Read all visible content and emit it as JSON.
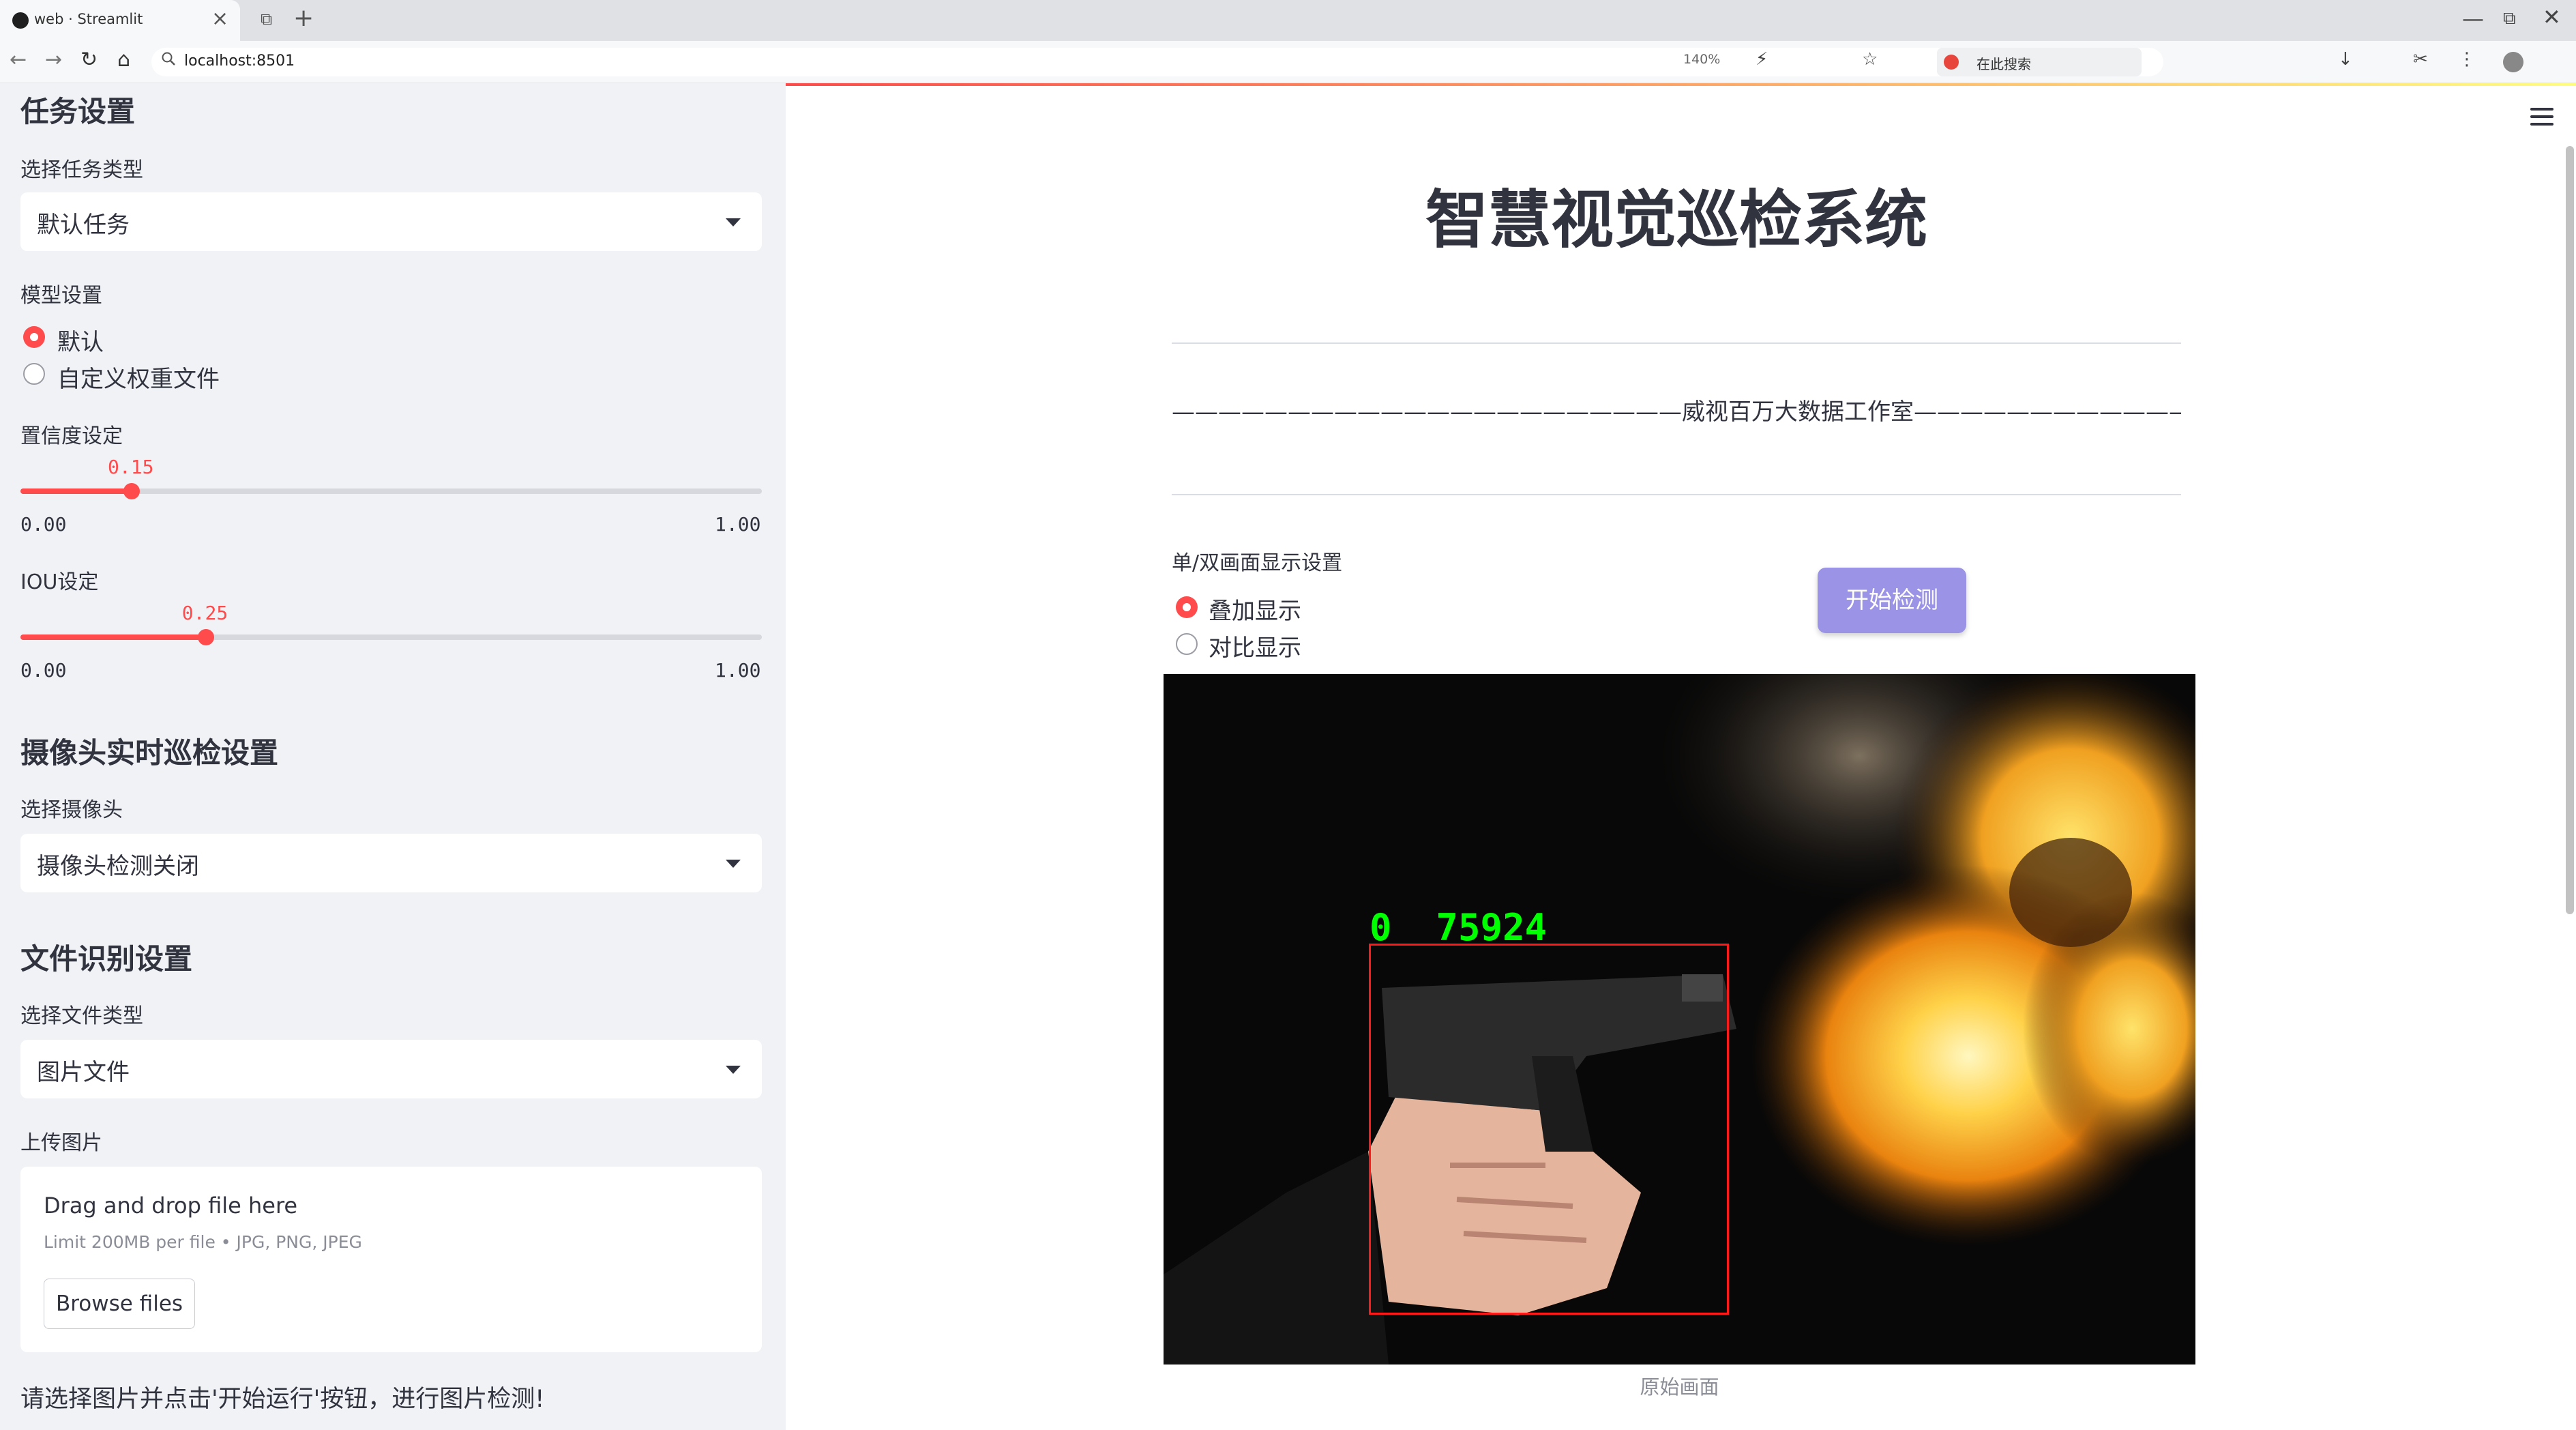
{
  "browser": {
    "tab_title": "web · Streamlit",
    "tab_close": "×",
    "tab_dup": "⧉",
    "tab_new": "+",
    "address": "localhost:8501",
    "zoom": "140%",
    "search_box": "在此搜索",
    "window_controls": {
      "minimize": "—",
      "restore": "⧉",
      "close": "✕"
    },
    "nav_icons": [
      "back-icon",
      "forward-icon",
      "reload-icon",
      "home-icon"
    ],
    "nav_glyphs": {
      "back": "←",
      "forward": "→",
      "reload": "↻",
      "home": "⌂"
    },
    "toolbar_glyphs": [
      "⚡",
      "☆",
      "↓",
      "✂",
      "⋮"
    ]
  },
  "sidebar": {
    "task_settings": {
      "heading": "任务设置",
      "select_label": "选择任务类型",
      "select_value": "默认任务"
    },
    "model_settings": {
      "label": "模型设置",
      "options": [
        "默认",
        "自定义权重文件"
      ],
      "selected_index": 0
    },
    "confidence": {
      "label": "置信度设定",
      "value": "0.15",
      "value_num": 0.15,
      "min": "0.00",
      "max": "1.00"
    },
    "iou": {
      "label": "IOU设定",
      "value": "0.25",
      "value_num": 0.25,
      "min": "0.00",
      "max": "1.00"
    },
    "camera": {
      "heading": "摄像头实时巡检设置",
      "select_label": "选择摄像头",
      "select_value": "摄像头检测关闭"
    },
    "file": {
      "heading": "文件识别设置",
      "select_label": "选择文件类型",
      "select_value": "图片文件",
      "upload_label": "上传图片",
      "drag_text": "Drag and drop file here",
      "limit_text": "Limit 200MB per file • JPG, PNG, JPEG",
      "browse_label": "Browse files"
    },
    "hint": "请选择图片并点击'开始运行'按钮，进行图片检测!"
  },
  "main": {
    "title": "智慧视觉巡检系统",
    "subtitle_line": "——————————————————————威视百万大数据工作室———————————————————————",
    "display_label": "单/双画面显示设置",
    "display_options": [
      "叠加显示",
      "对比显示"
    ],
    "display_selected": 0,
    "start_button": "开始检测",
    "detection_label": "0  75924",
    "image_caption": "原始画面"
  },
  "colors": {
    "accent": "#ff4b4b",
    "sidebar_bg": "#f0f2f6",
    "button_bg": "#9a93e6",
    "detection_box": "#ff1a1a",
    "detection_text": "#00ff00"
  }
}
